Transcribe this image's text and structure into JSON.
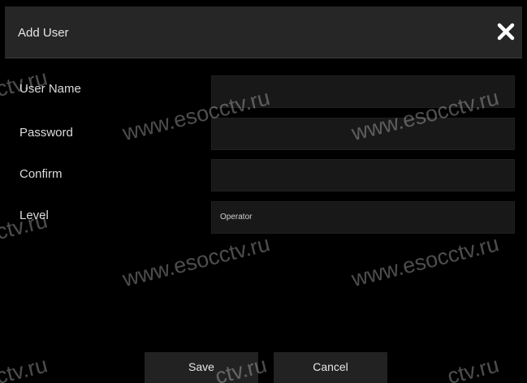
{
  "dialog": {
    "title": "Add User",
    "close_icon": "close-icon"
  },
  "form": {
    "user_name_label": "User Name",
    "user_name_value": "",
    "password_label": "Password",
    "password_value": "",
    "confirm_label": "Confirm",
    "confirm_value": "",
    "level_label": "Level",
    "level_value": "Operator"
  },
  "buttons": {
    "save_label": "Save",
    "cancel_label": "Cancel"
  },
  "watermark": {
    "full_text": "www.esocctv.ru",
    "partial_text": "ctv.ru"
  },
  "colors": {
    "background": "#000000",
    "titlebar": "#262626",
    "field": "#181818",
    "button": "#222222",
    "text": "#e6e6e6"
  }
}
